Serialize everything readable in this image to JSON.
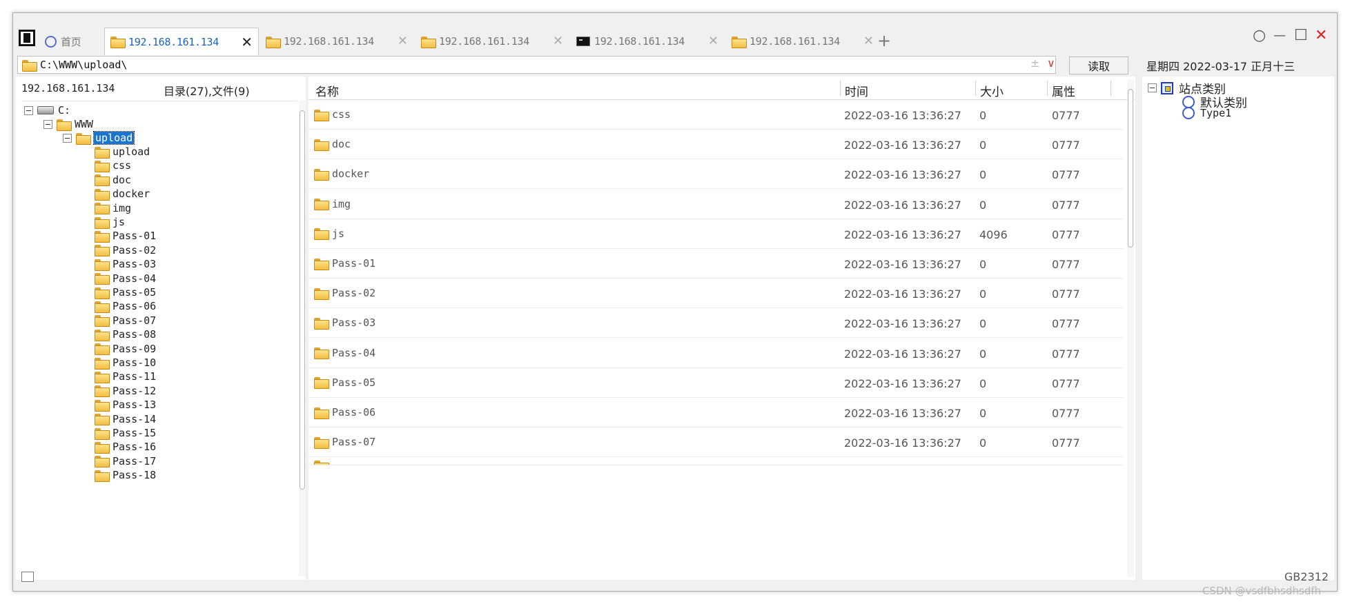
{
  "tabs": {
    "home": {
      "label": "首页",
      "icon": "globe-icon"
    },
    "items": [
      {
        "label": "192.168.161.134",
        "icon": "folder-icon",
        "close": "✕",
        "active": true
      },
      {
        "label": "192.168.161.134",
        "icon": "folder-icon",
        "close": "✕",
        "active": false
      },
      {
        "label": "192.168.161.134",
        "icon": "folder-icon",
        "close": "✕",
        "active": false
      },
      {
        "label": "192.168.161.134",
        "icon": "terminal-icon",
        "close": "✕",
        "active": false
      },
      {
        "label": "192.168.161.134",
        "icon": "folder-icon",
        "close": "✕",
        "active": false
      }
    ],
    "add": "+"
  },
  "window_controls": {
    "circle": "○",
    "minimize": "—",
    "maximize": "☐",
    "close": "✕",
    "close_color": "#e02020"
  },
  "address": {
    "path": "C:\\WWW\\upload\\",
    "extra": "±",
    "dropdown": "∨",
    "read_button": "读取"
  },
  "date": {
    "text": "星期四 2022-03-17 正月十三"
  },
  "left_panel": {
    "host": "192.168.161.134",
    "counts": "目录(27),文件(9)",
    "tree": {
      "drive": "C:",
      "www": "WWW",
      "upload": "upload",
      "children": [
        "upload",
        "css",
        "doc",
        "docker",
        "img",
        "js",
        "Pass-01",
        "Pass-02",
        "Pass-03",
        "Pass-04",
        "Pass-05",
        "Pass-06",
        "Pass-07",
        "Pass-08",
        "Pass-09",
        "Pass-10",
        "Pass-11",
        "Pass-12",
        "Pass-13",
        "Pass-14",
        "Pass-15",
        "Pass-16",
        "Pass-17",
        "Pass-18"
      ]
    }
  },
  "file_list": {
    "columns": {
      "name": "名称",
      "time": "时间",
      "size": "大小",
      "attr": "属性"
    },
    "rows": [
      {
        "name": "css",
        "time": "2022-03-16 13:36:27",
        "size": "0",
        "attr": "0777"
      },
      {
        "name": "doc",
        "time": "2022-03-16 13:36:27",
        "size": "0",
        "attr": "0777"
      },
      {
        "name": "docker",
        "time": "2022-03-16 13:36:27",
        "size": "0",
        "attr": "0777"
      },
      {
        "name": "img",
        "time": "2022-03-16 13:36:27",
        "size": "0",
        "attr": "0777"
      },
      {
        "name": "js",
        "time": "2022-03-16 13:36:27",
        "size": "4096",
        "attr": "0777"
      },
      {
        "name": "Pass-01",
        "time": "2022-03-16 13:36:27",
        "size": "0",
        "attr": "0777"
      },
      {
        "name": "Pass-02",
        "time": "2022-03-16 13:36:27",
        "size": "0",
        "attr": "0777"
      },
      {
        "name": "Pass-03",
        "time": "2022-03-16 13:36:27",
        "size": "0",
        "attr": "0777"
      },
      {
        "name": "Pass-04",
        "time": "2022-03-16 13:36:27",
        "size": "0",
        "attr": "0777"
      },
      {
        "name": "Pass-05",
        "time": "2022-03-16 13:36:27",
        "size": "0",
        "attr": "0777"
      },
      {
        "name": "Pass-06",
        "time": "2022-03-16 13:36:27",
        "size": "0",
        "attr": "0777"
      },
      {
        "name": "Pass-07",
        "time": "2022-03-16 13:36:27",
        "size": "0",
        "attr": "0777"
      }
    ]
  },
  "right_panel": {
    "root": "站点类别",
    "children": [
      "默认类别",
      "Type1"
    ]
  },
  "status": {
    "encoding": "GB2312"
  },
  "watermark": "CSDN @vsdfbhsdhsdfh",
  "colors": {
    "selection": "#1c74d1",
    "active_tab_text": "#1b63b8",
    "folder": "#f2bd42"
  }
}
